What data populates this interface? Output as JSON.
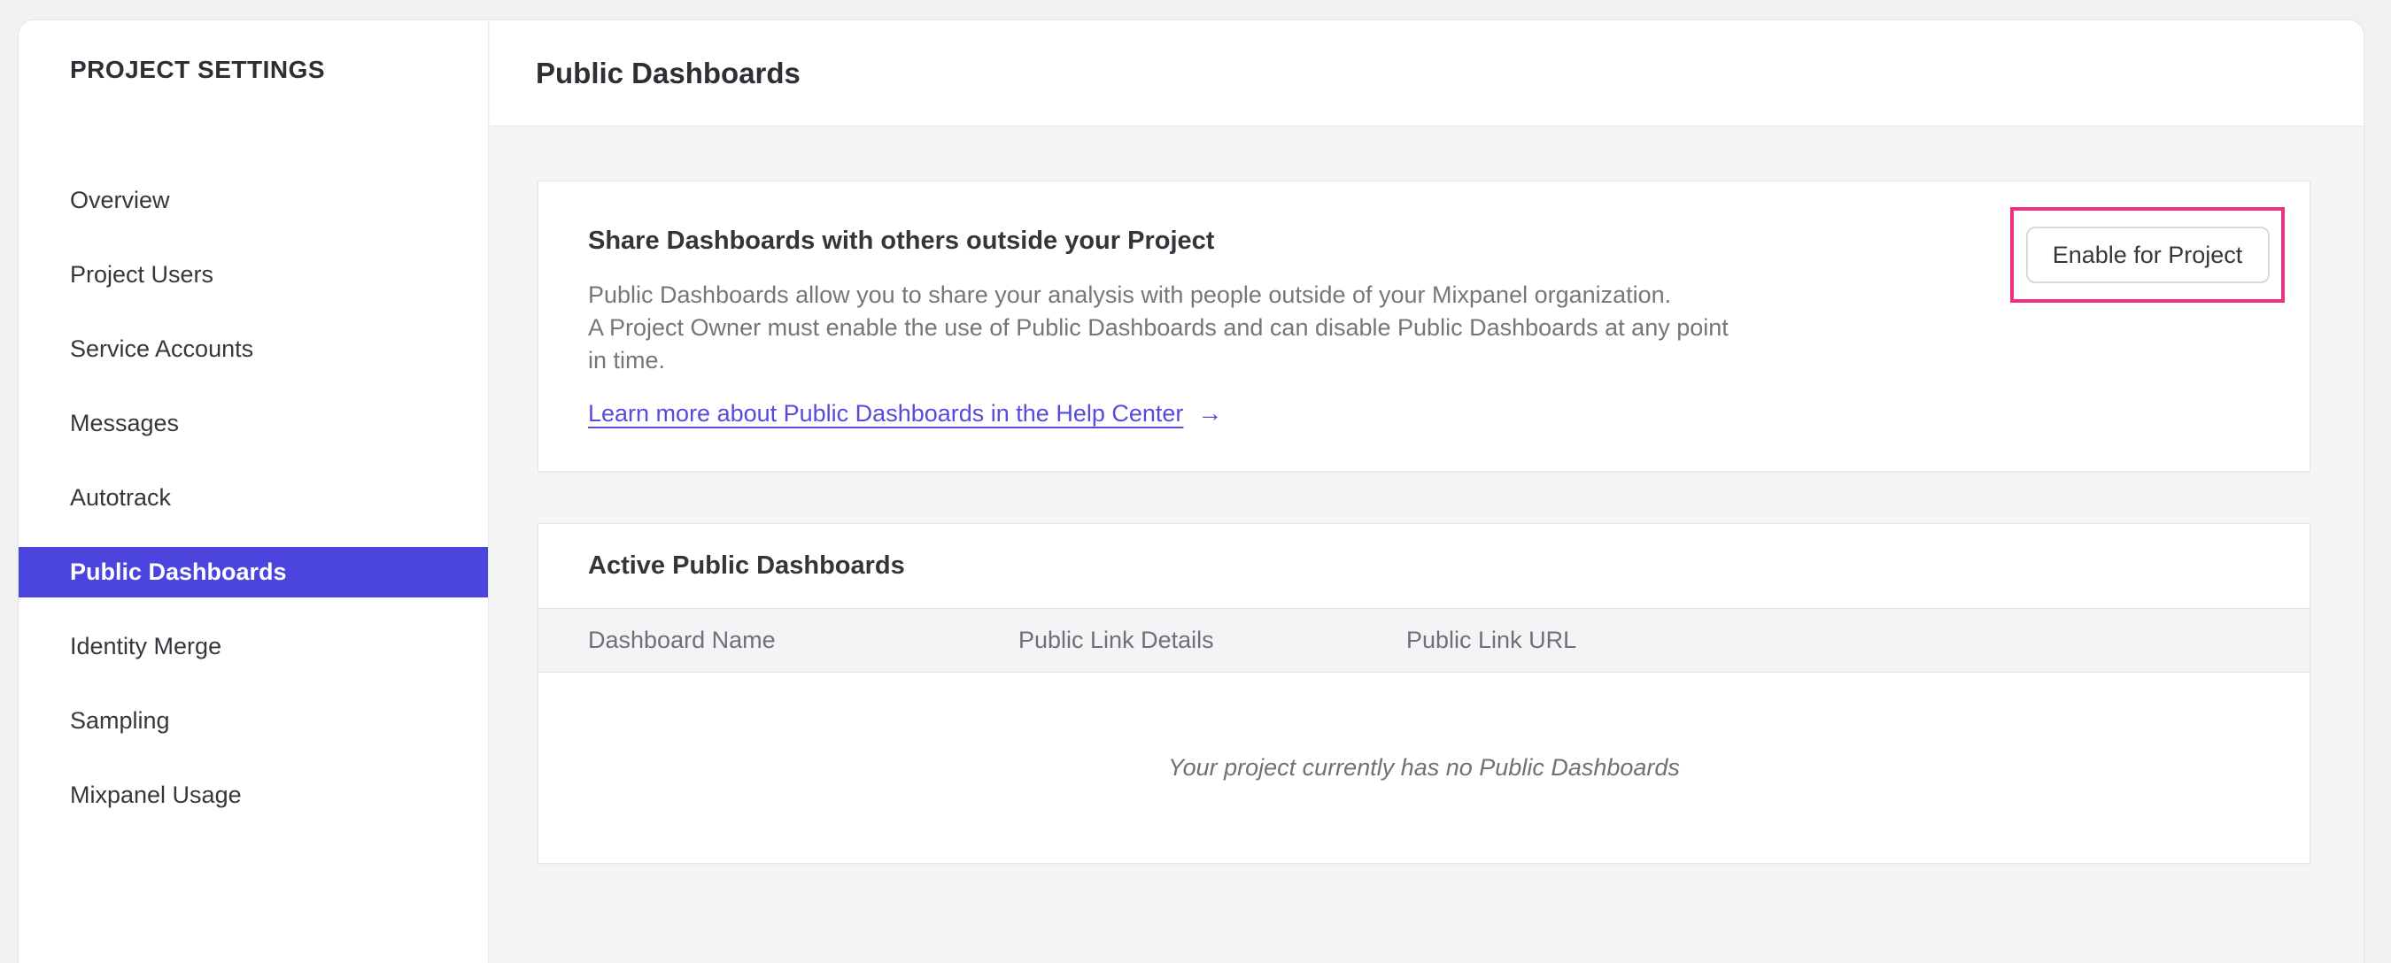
{
  "sidebar": {
    "title": "PROJECT SETTINGS",
    "items": [
      {
        "label": "Overview",
        "selected": false
      },
      {
        "label": "Project Users",
        "selected": false
      },
      {
        "label": "Service Accounts",
        "selected": false
      },
      {
        "label": "Messages",
        "selected": false
      },
      {
        "label": "Autotrack",
        "selected": false
      },
      {
        "label": "Public Dashboards",
        "selected": true
      },
      {
        "label": "Identity Merge",
        "selected": false
      },
      {
        "label": "Sampling",
        "selected": false
      },
      {
        "label": "Mixpanel Usage",
        "selected": false
      }
    ]
  },
  "header": {
    "title": "Public Dashboards"
  },
  "share_card": {
    "title": "Share Dashboards with others outside your Project",
    "body_lines": [
      "Public Dashboards allow you to share your analysis with people outside of your Mixpanel organization.",
      "A Project Owner must enable the use of Public Dashboards and can disable Public Dashboards at any point",
      "in time."
    ],
    "link_label": "Learn more about Public Dashboards in the Help Center",
    "link_arrow": "→",
    "button_label": "Enable for Project"
  },
  "dashboards_card": {
    "title": "Active Public Dashboards",
    "columns": [
      "Dashboard Name",
      "Public Link Details",
      "Public Link URL"
    ],
    "rows": [],
    "empty_message": "Your project currently has no Public Dashboards"
  },
  "colors": {
    "selected_nav_bg": "#4b44df",
    "link": "#554cdd",
    "annotation_pink": "#e93383",
    "card_border": "#e6e6e9",
    "body_text": "#73777c",
    "heading_text": "#32363b"
  }
}
